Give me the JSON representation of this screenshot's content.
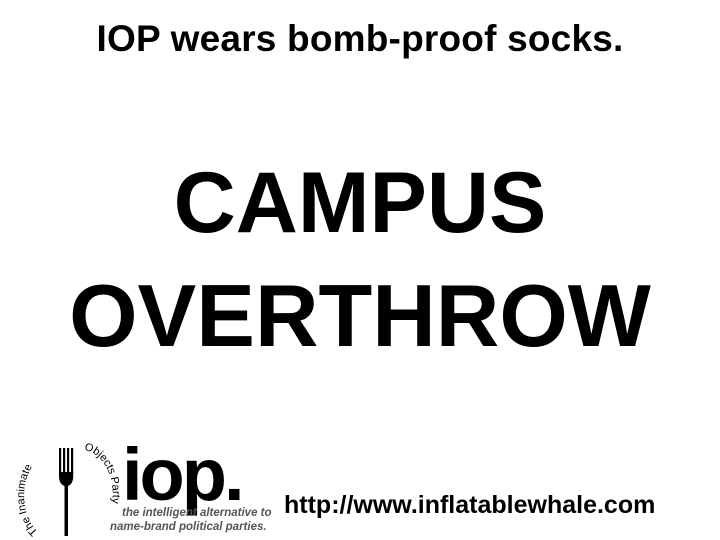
{
  "tagline": "IOP wears bomb-proof socks.",
  "headline": {
    "line1": "CAMPUS",
    "line2": "OVERTHROW"
  },
  "logo": {
    "seal_text_left": "The Inanimate",
    "seal_text_right": "Objects Party",
    "wordmark": "iop.",
    "subline1": "the intelligent alternative to",
    "subline2": "name-brand political parties."
  },
  "url": "http://www.inflatablewhale.com",
  "colors": {
    "background": "#ffffff",
    "text": "#000000",
    "subtext": "#555555"
  }
}
